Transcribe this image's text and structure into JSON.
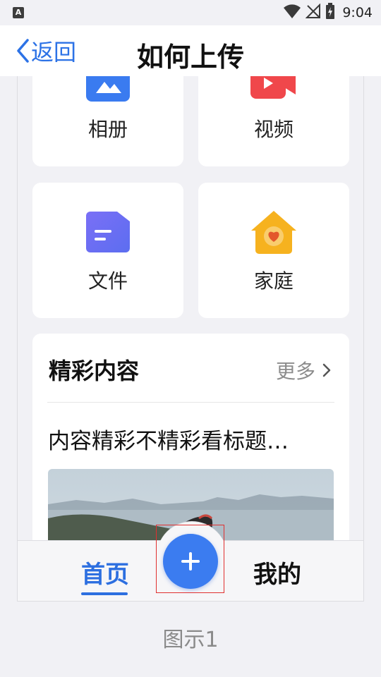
{
  "status_bar": {
    "notification_icon": "A",
    "time": "9:04",
    "icons": [
      "wifi-icon",
      "no-signal-icon",
      "battery-charging-icon"
    ]
  },
  "header": {
    "back_label": "返回",
    "title": "如何上传"
  },
  "tiles": [
    {
      "label": "相册",
      "icon": "album-icon",
      "color": "#3a7bf0"
    },
    {
      "label": "视频",
      "icon": "video-icon",
      "color": "#f0474b"
    },
    {
      "label": "文件",
      "icon": "file-icon",
      "color": "#6b6cf3"
    },
    {
      "label": "家庭",
      "icon": "home-icon",
      "color": "#f6b21f"
    }
  ],
  "content_section": {
    "title": "精彩内容",
    "more_label": "更多",
    "article_title": "内容精彩不精彩看标题…"
  },
  "tab_bar": {
    "home_label": "首页",
    "mine_label": "我的",
    "add_button": "plus-icon"
  },
  "caption": "图示1",
  "colors": {
    "accent": "#2d6fe0",
    "highlight_box": "#e03030",
    "background": "#f1f1f5"
  }
}
